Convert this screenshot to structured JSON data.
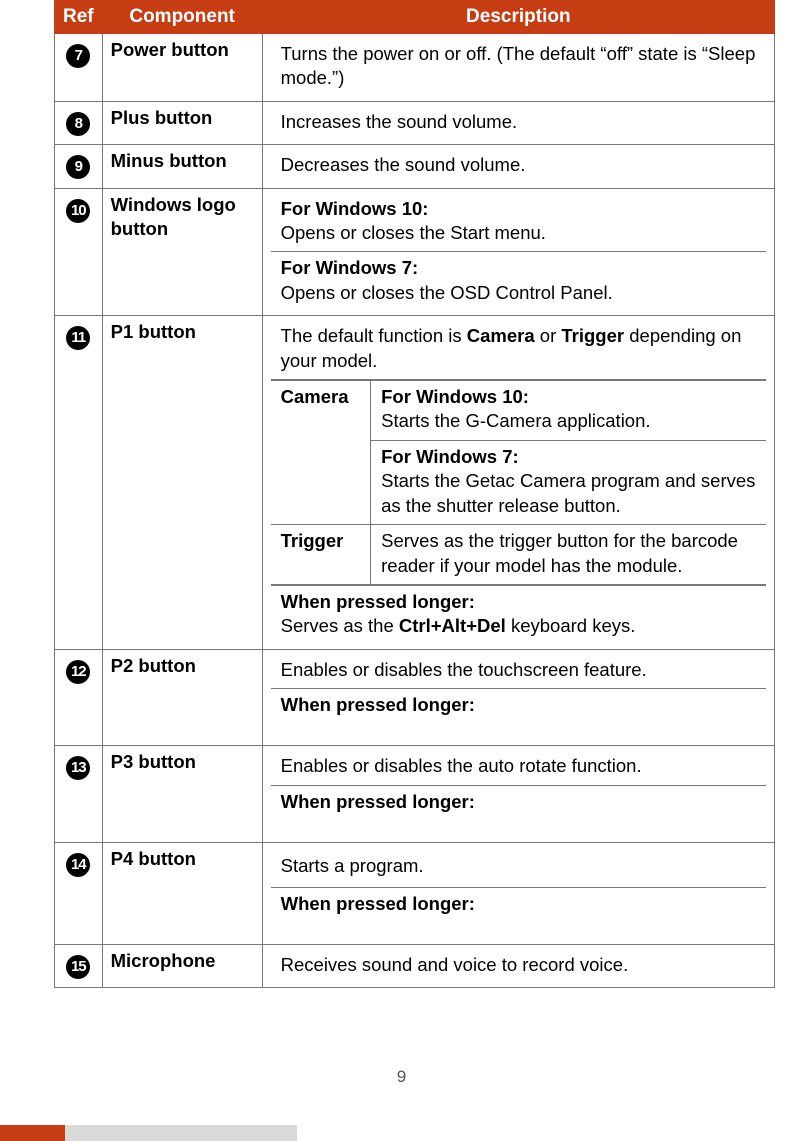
{
  "headers": {
    "ref": "Ref",
    "component": "Component",
    "description": "Description"
  },
  "rows": {
    "r7": {
      "ref": "7",
      "component": "Power button",
      "desc": "Turns the power on or off. (The default “off” state is “Sleep mode.”)"
    },
    "r8": {
      "ref": "8",
      "component": "Plus button",
      "desc": "Increases the sound volume."
    },
    "r9": {
      "ref": "9",
      "component": "Minus button",
      "desc": "Decreases the sound volume."
    },
    "r10": {
      "ref": "10",
      "component": "Windows logo button",
      "w10_t": "For Windows 10:",
      "w10_b": "Opens or closes the Start menu.",
      "w7_t": "For Windows 7:",
      "w7_b": "Opens or closes the OSD Control Panel."
    },
    "r11": {
      "ref": "11",
      "component": "P1 button",
      "intro_a": "The default function is ",
      "intro_b1": "Camera",
      "intro_mid": " or ",
      "intro_b2": "Trigger",
      "intro_c": " depending on your model.",
      "camera_label": "Camera",
      "cam_w10_t": "For Windows 10:",
      "cam_w10_b": "Starts the G-Camera application.",
      "cam_w7_t": "For Windows 7:",
      "cam_w7_b": "Starts the Getac Camera program and serves as the shutter release button.",
      "trigger_label": "Trigger",
      "trigger_b": "Serves as the trigger button for the barcode reader if your model has the module.",
      "long_t": "When pressed longer:",
      "long_a": "Serves as the ",
      "long_b": "Ctrl+Alt+Del",
      "long_c": " keyboard keys."
    },
    "r12": {
      "ref": "12",
      "component": "P2 button",
      "desc": "Enables or disables the touchscreen feature.",
      "long_t": "When pressed longer:"
    },
    "r13": {
      "ref": "13",
      "component": "P3 button",
      "desc": "Enables or disables the auto rotate function.",
      "long_t": "When pressed longer:"
    },
    "r14": {
      "ref": "14",
      "component": "P4 button",
      "desc": "Starts a program.",
      "long_t": "When pressed longer:"
    },
    "r15": {
      "ref": "15",
      "component": "Microphone",
      "desc": "Receives sound and voice to record voice."
    }
  },
  "page_number": "9"
}
